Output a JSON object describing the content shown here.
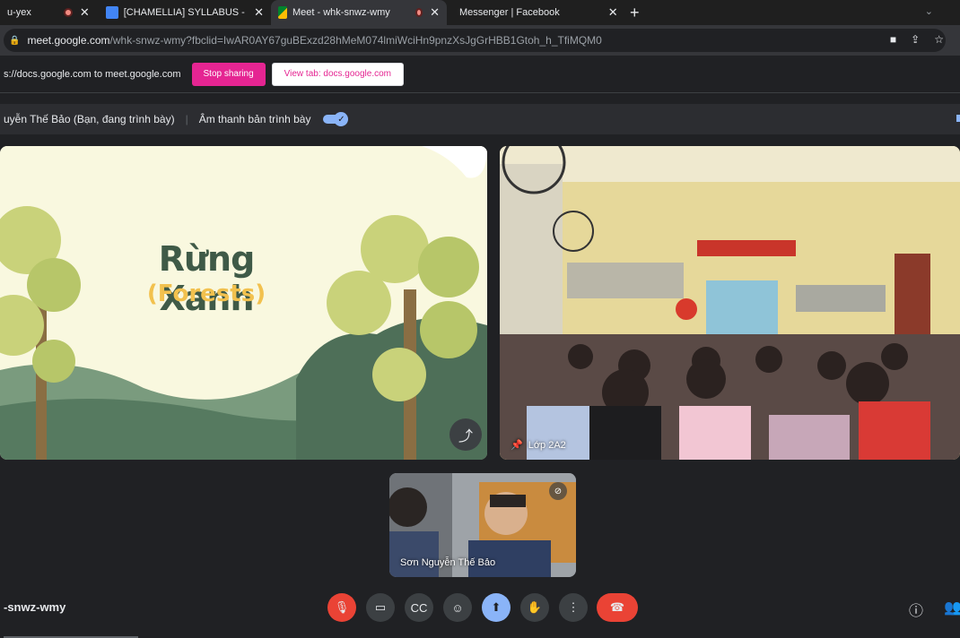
{
  "tabs": [
    {
      "title": "u-yex",
      "recording": true,
      "active": false
    },
    {
      "title": "[CHAMELLIA] SYLLABUS - ONLII",
      "icon": "docs-icon",
      "active": false
    },
    {
      "title": "Meet - whk-snwz-wmy",
      "icon": "meet-icon",
      "recording": true,
      "active": true
    },
    {
      "title": "Messenger | Facebook",
      "icon": "facebook-icon",
      "active": false
    }
  ],
  "address": {
    "host": "meet.google.com",
    "path": "/whk-snwz-wmy?fbclid=IwAR0AY67guBExzd28hMeM074lmiWciHn9pnzXsJgGrHBB1Gtoh_h_TfiMQM0"
  },
  "sharing": {
    "text": "s://docs.google.com to meet.google.com",
    "stop_label": "Stop sharing",
    "view_label": "View tab: docs.google.com"
  },
  "presenter": {
    "name": "uyễn Thế Bảo (Bạn, đang trình bày)",
    "audio_label": "Âm thanh bản trình bày"
  },
  "slide": {
    "title": "Rừng Xanh",
    "subtitle": "(Forests)"
  },
  "tiles": {
    "classroom_label": "Lớp 2A2",
    "self_label": "Sơn Nguyễn Thế Bảo"
  },
  "meeting_code": "-snwz-wmy",
  "colors": {
    "accent": "#8ab4f8",
    "stop_button": "#e52592",
    "danger": "#ea4335",
    "background": "#202124"
  }
}
